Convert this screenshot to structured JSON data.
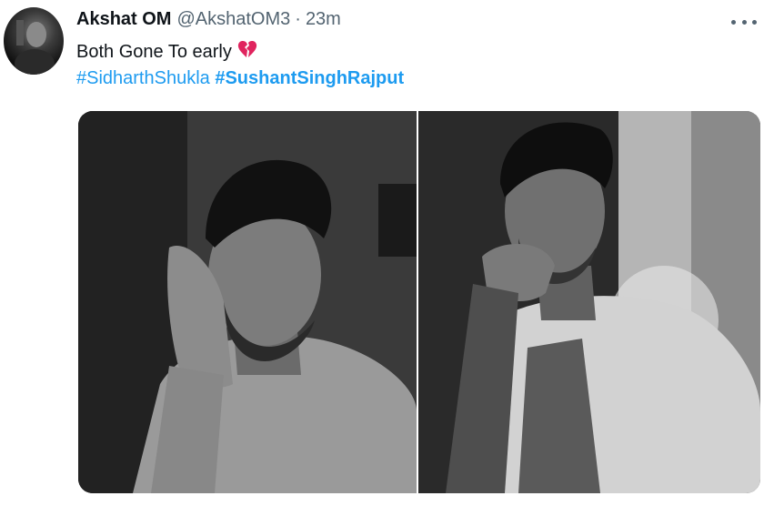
{
  "tweet": {
    "display_name": "Akshat OM",
    "handle": "@AkshatOM3",
    "separator": "·",
    "time": "23m",
    "text": "Both Gone To early",
    "emoji": "broken-heart-icon",
    "hashtags": [
      {
        "label": "#SidharthShukla",
        "bold": false
      },
      {
        "label": "#SushantSinghRajput",
        "bold": true
      }
    ],
    "photos": [
      {
        "name": "sidharth-shukla-photo"
      },
      {
        "name": "sushant-singh-rajput-photo"
      }
    ]
  },
  "colors": {
    "text": "#0f1419",
    "secondary": "#536471",
    "link": "#1d9bf0",
    "emoji": "#e0245e"
  }
}
